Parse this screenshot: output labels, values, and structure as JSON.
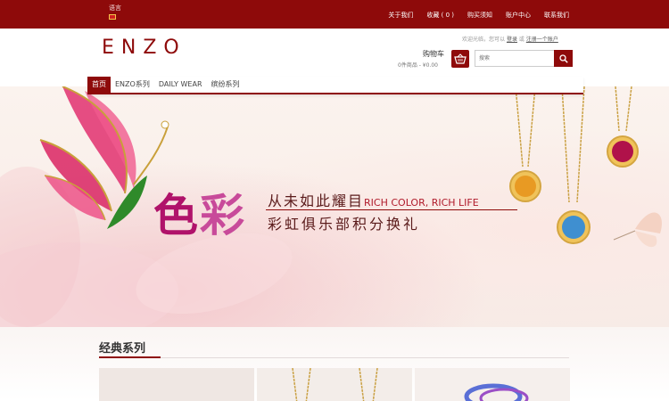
{
  "topbar": {
    "lang_label": "语言",
    "nav": [
      "关于我们",
      "收藏 ( 0 )",
      "购买须知",
      "账户中心",
      "联系我们"
    ]
  },
  "header": {
    "logo": "ENZO",
    "welcome_prefix": "欢迎光临，您可以",
    "login_label": "登录",
    "welcome_mid": "或",
    "register_label": "注册一个账户",
    "cart_title": "购物车",
    "cart_info": "0件商品 - ¥0.00",
    "search_placeholder": "搜索"
  },
  "nav": {
    "items": [
      "首页",
      "ENZO系列",
      "DAILY WEAR",
      "缤纷系列"
    ],
    "active_index": 0
  },
  "banner": {
    "big_text_1": "色",
    "big_text_2": "彩",
    "line1_cn": "从未如此耀目",
    "line1_en": "RICH COLOR, RICH LIFE",
    "line2": "彩虹俱乐部积分换礼"
  },
  "section": {
    "title": "经典系列"
  },
  "colors": {
    "brand": "#8e0a0a",
    "banner_accent": "#b0126a"
  }
}
